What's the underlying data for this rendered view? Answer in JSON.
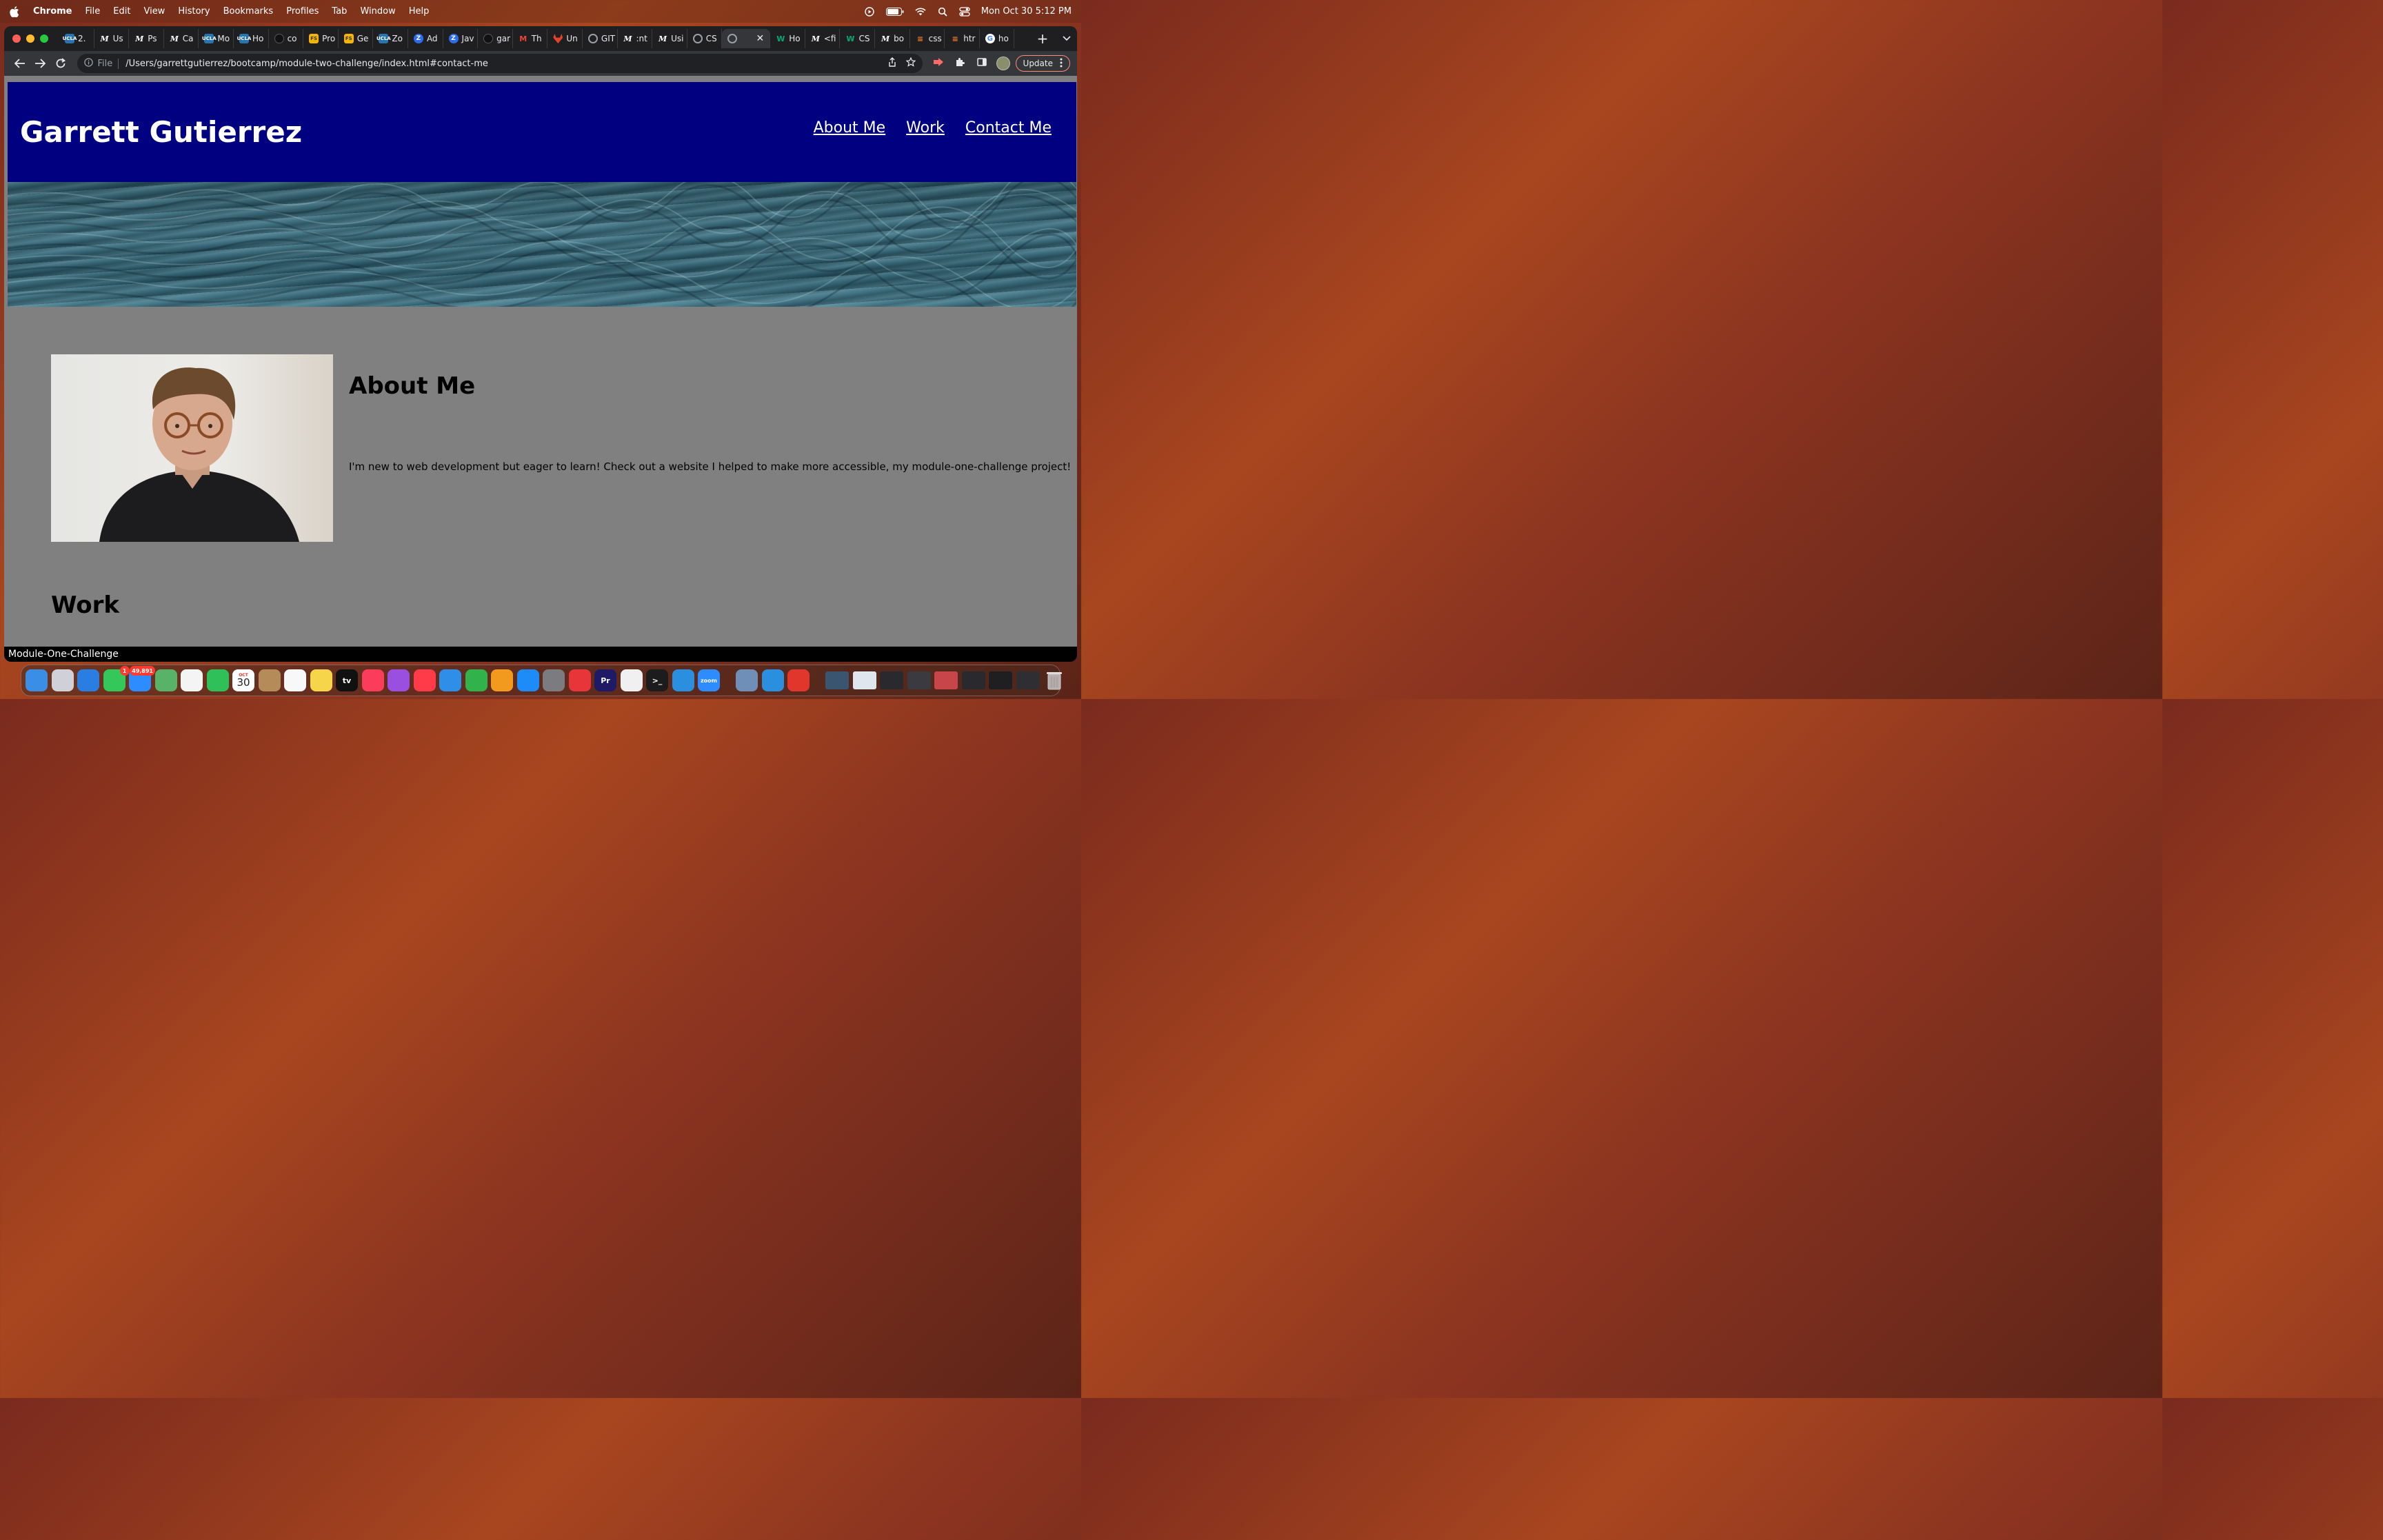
{
  "menubar": {
    "app_name": "Chrome",
    "menus": [
      "File",
      "Edit",
      "View",
      "History",
      "Bookmarks",
      "Profiles",
      "Tab",
      "Window",
      "Help"
    ],
    "clock": "Mon Oct 30  5:12 PM",
    "icons": [
      "play-circle-icon",
      "battery-icon",
      "wifi-icon",
      "spotlight-icon",
      "control-center-icon"
    ]
  },
  "tabs": [
    {
      "favicon": "ucla",
      "title": "2."
    },
    {
      "favicon": "m",
      "title": "Us"
    },
    {
      "favicon": "m",
      "title": "Ps"
    },
    {
      "favicon": "m",
      "title": "Ca"
    },
    {
      "favicon": "ucla",
      "title": "Mo"
    },
    {
      "favicon": "ucla",
      "title": "Ho"
    },
    {
      "favicon": "gh",
      "title": "co"
    },
    {
      "favicon": "fs",
      "title": "Pro"
    },
    {
      "favicon": "fs",
      "title": "Ge"
    },
    {
      "favicon": "ucla",
      "title": "Zo"
    },
    {
      "favicon": "z",
      "title": "Ad"
    },
    {
      "favicon": "z",
      "title": "Jav"
    },
    {
      "favicon": "gh",
      "title": "gar"
    },
    {
      "favicon": "gmail",
      "title": "Th"
    },
    {
      "favicon": "gitlab",
      "title": "Un"
    },
    {
      "favicon": "globe",
      "title": "GIT"
    },
    {
      "favicon": "m",
      "title": ":nt"
    },
    {
      "favicon": "m",
      "title": "Usi"
    },
    {
      "favicon": "globe",
      "title": "CS"
    },
    {
      "favicon": "globe",
      "title": "",
      "active": true
    },
    {
      "favicon": "w",
      "title": "Ho"
    },
    {
      "favicon": "m",
      "title": "<fi"
    },
    {
      "favicon": "w",
      "title": "CS"
    },
    {
      "favicon": "m",
      "title": "bo"
    },
    {
      "favicon": "so",
      "title": "css"
    },
    {
      "favicon": "so",
      "title": "htr"
    },
    {
      "favicon": "g",
      "title": "ho"
    }
  ],
  "toolbar": {
    "scheme_label": "File",
    "url": "/Users/garrettgutierrez/bootcamp/module-two-challenge/index.html#contact-me",
    "update_label": "Update"
  },
  "page": {
    "site_title": "Garrett Gutierrez",
    "nav": [
      "About Me",
      "Work",
      "Contact Me"
    ],
    "about_heading": "About Me",
    "about_text": "I'm new to web development but eager to learn! Check out a website I helped to make more accessible, my module-one-challenge project!",
    "work_heading": "Work",
    "colors": {
      "header_bg": "#000080",
      "page_bg": "#808080"
    }
  },
  "status_bar": {
    "hover_link": "Module-One-Challenge"
  },
  "dock": {
    "apps": [
      {
        "name": "finder",
        "color": "#3a8ee6"
      },
      {
        "name": "launchpad",
        "color": "#d0d0d8"
      },
      {
        "name": "safari",
        "color": "#2a7de1"
      },
      {
        "name": "messages",
        "color": "#34c759",
        "badge": "1"
      },
      {
        "name": "mail",
        "color": "#2d8cff",
        "badge": "49,891"
      },
      {
        "name": "maps",
        "color": "#58b368"
      },
      {
        "name": "photos",
        "color": "#f4f4f4"
      },
      {
        "name": "facetime",
        "color": "#30c05a"
      },
      {
        "name": "calendar",
        "date_month": "OCT",
        "date_day": "30"
      },
      {
        "name": "contacts",
        "color": "#b58b5a"
      },
      {
        "name": "reminders",
        "color": "#f8f8f8"
      },
      {
        "name": "notes",
        "color": "#f7d54a"
      },
      {
        "name": "apple-tv",
        "color": "#111111",
        "label": "tv"
      },
      {
        "name": "music",
        "color": "#fb3c5a"
      },
      {
        "name": "podcasts",
        "color": "#9b4fe0"
      },
      {
        "name": "news",
        "color": "#ff3b4a"
      },
      {
        "name": "keynote",
        "color": "#2f8ee8"
      },
      {
        "name": "numbers",
        "color": "#31b24b"
      },
      {
        "name": "pages",
        "color": "#f29a1e"
      },
      {
        "name": "app-store",
        "color": "#1d8cf8"
      },
      {
        "name": "system-settings",
        "color": "#7c7c80"
      },
      {
        "name": "creative-cloud",
        "color": "#e8353a"
      },
      {
        "name": "premiere-pro",
        "color": "#1e1a66",
        "label": "Pr"
      },
      {
        "name": "chrome",
        "color": "#f0f0f0"
      },
      {
        "name": "terminal",
        "color": "#1c1c1c",
        "label": ">_"
      },
      {
        "name": "vscode",
        "color": "#2b8fe0"
      },
      {
        "name": "zoom",
        "color": "#2d8cff",
        "label": "zoom"
      }
    ],
    "recent": [
      {
        "name": "preview",
        "color": "#6f8fb8"
      },
      {
        "name": "vscode-insiders",
        "color": "#2b8fe0"
      },
      {
        "name": "pdf-app",
        "color": "#e0362c"
      }
    ],
    "windows": [
      {
        "name": "minimized-window-1",
        "color": "#3a5570"
      },
      {
        "name": "minimized-window-2",
        "color": "#dfe6ee"
      },
      {
        "name": "minimized-window-3",
        "color": "#2a2a2e"
      },
      {
        "name": "minimized-window-4",
        "color": "#3a3a40"
      },
      {
        "name": "minimized-window-5",
        "color": "#c8454a"
      },
      {
        "name": "minimized-window-6",
        "color": "#2a2a2e"
      },
      {
        "name": "minimized-window-7",
        "color": "#1f1f22"
      },
      {
        "name": "minimized-window-8",
        "color": "#2f2f33"
      }
    ]
  }
}
